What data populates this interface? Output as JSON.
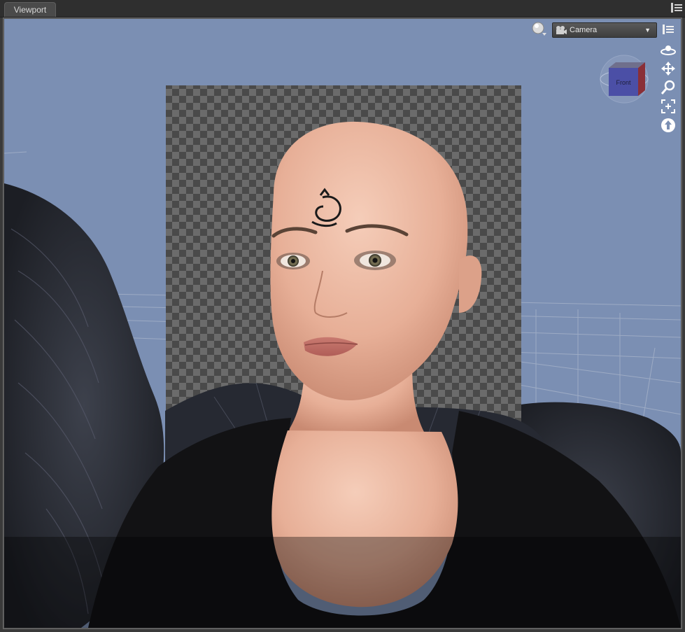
{
  "tab": {
    "label": "Viewport"
  },
  "viewport": {
    "camera_dropdown": {
      "selected": "Camera",
      "icon": "camera-icon"
    },
    "view_cube": {
      "face_label": "Front"
    },
    "nav_tools": [
      {
        "name": "orbit-icon"
      },
      {
        "name": "pan-icon"
      },
      {
        "name": "zoom-icon"
      },
      {
        "name": "frame-icon"
      },
      {
        "name": "reset-view-icon"
      }
    ]
  },
  "colors": {
    "background": "#7b8fb3",
    "panel": "#3a3a3a",
    "checker_dark": "#4a4a4a",
    "checker_light": "#6b6b6b",
    "skin": "#e9b39c",
    "feathers": "#2b2e37"
  }
}
